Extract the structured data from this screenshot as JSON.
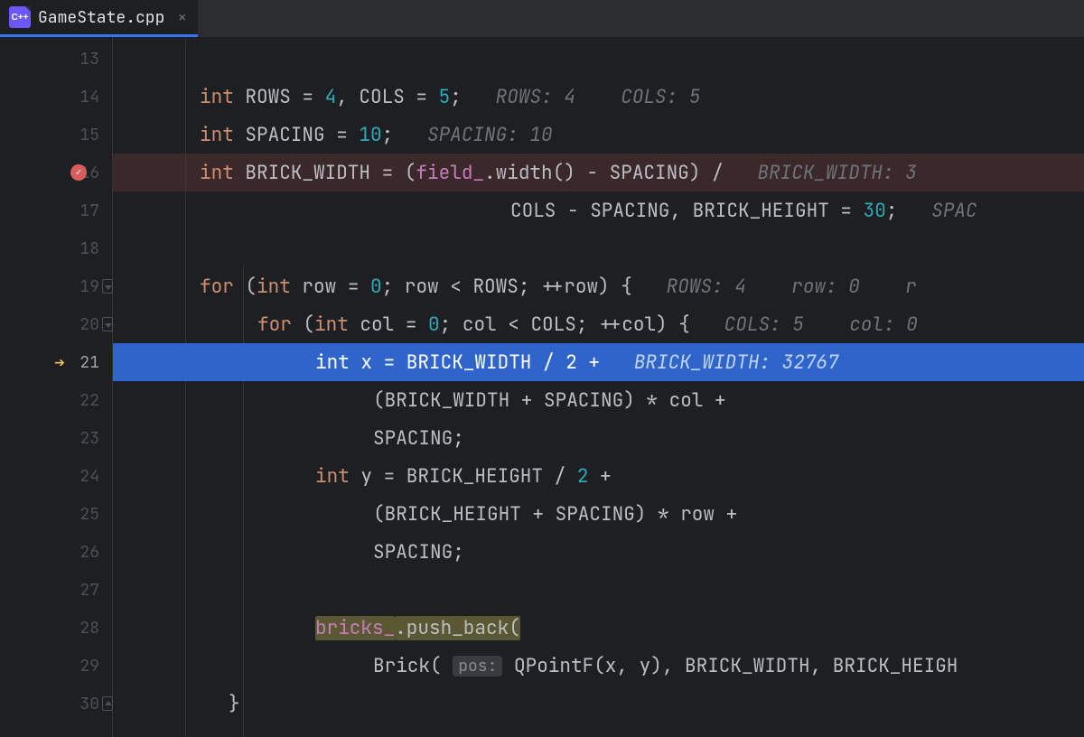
{
  "tab": {
    "filename": "GameState.cpp",
    "lang_badge": "C++"
  },
  "gutter": {
    "lines": [
      13,
      14,
      15,
      16,
      17,
      18,
      19,
      20,
      21,
      22,
      23,
      24,
      25,
      26,
      27,
      28,
      29,
      30
    ],
    "breakpoint_line": 16,
    "execution_line": 21,
    "fold_down_lines": [
      19,
      20
    ],
    "fold_up_lines": [
      30
    ]
  },
  "code": {
    "l13": "",
    "l14_kw": "int",
    "l14_a": " ROWS = ",
    "l14_n1": "4",
    "l14_b": ", COLS = ",
    "l14_n2": "5",
    "l14_c": ";   ",
    "l14_hint": "ROWS: 4    COLS: 5",
    "l15_kw": "int",
    "l15_a": " SPACING = ",
    "l15_n": "10",
    "l15_b": ";   ",
    "l15_hint": "SPACING: 10",
    "l16_kw": "int",
    "l16_a": " BRICK_WIDTH = (",
    "l16_fld": "field_",
    "l16_b": ".width() - SPACING) /   ",
    "l16_hint": "BRICK_WIDTH: 3",
    "l17_a": "COLS - SPACING, BRICK_HEIGHT = ",
    "l17_n": "30",
    "l17_b": ";   ",
    "l17_hint": "SPAC",
    "l19_kw1": "for",
    "l19_a": " (",
    "l19_kw2": "int",
    "l19_b": " row = ",
    "l19_n": "0",
    "l19_c": "; row < ROWS; ++row) {   ",
    "l19_hint": "ROWS: 4    row: 0    r",
    "l20_kw1": "for",
    "l20_a": " (",
    "l20_kw2": "int",
    "l20_b": " col = ",
    "l20_n": "0",
    "l20_c": "; col < COLS; ++col) {   ",
    "l20_hint": "COLS: 5    col: 0",
    "l21_kw": "int",
    "l21_a": " x = BRICK_WIDTH / ",
    "l21_n": "2",
    "l21_b": " +   ",
    "l21_hint": "BRICK_WIDTH: 32767",
    "l22": "(BRICK_WIDTH + SPACING) * col +",
    "l23": "SPACING;",
    "l24_kw": "int",
    "l24_a": " y = BRICK_HEIGHT / ",
    "l24_n": "2",
    "l24_b": " +",
    "l25": "(BRICK_HEIGHT + SPACING) * row +",
    "l26": "SPACING;",
    "l28_fld": "bricks_",
    "l28_a": ".push_back(",
    "l29_a": "Brick( ",
    "l29_ph": "pos:",
    "l29_b": " QPointF(x, y), BRICK_WIDTH, BRICK_HEIGH",
    "l30": "}"
  }
}
